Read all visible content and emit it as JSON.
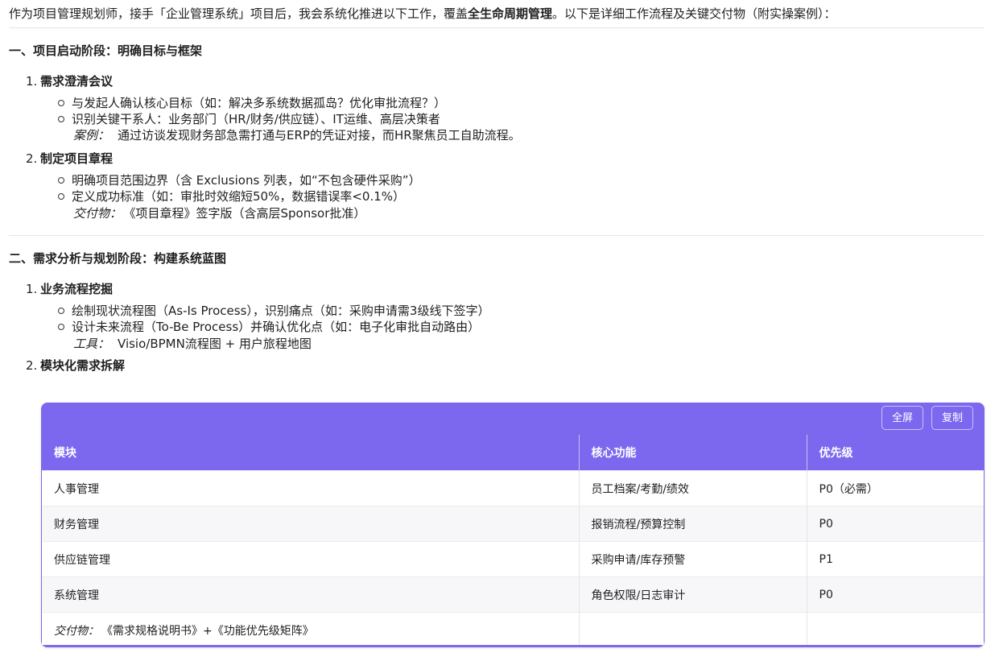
{
  "intro": {
    "part1": "作为项目管理规划师，接手「企业管理系统」项目后，我会系统化推进以下工作，覆盖",
    "bold": "全生命周期管理",
    "part2": "。以下是详细工作流程及关键交付物（附实操案例）："
  },
  "section1": {
    "title": "一、项目启动阶段：明确目标与框架",
    "item1": {
      "num": "1.",
      "title": "需求澄清会议",
      "bullets": [
        "与发起人确认核心目标（如：解决多系统数据孤岛？优化审批流程？）",
        "识别关键干系人：业务部门（HR/财务/供应链）、IT运维、高层决策者"
      ],
      "note_label": "案例：",
      "note_text": "通过访谈发现财务部急需打通与ERP的凭证对接，而HR聚焦员工自助流程。"
    },
    "item2": {
      "num": "2.",
      "title": "制定项目章程",
      "bullets": [
        "明确项目范围边界（含 Exclusions 列表，如“不包含硬件采购”）",
        "定义成功标准（如：审批时效缩短50%，数据错误率<0.1%）"
      ],
      "note_label": "交付物：",
      "note_text": "《项目章程》签字版（含高层Sponsor批准）"
    }
  },
  "section2": {
    "title": "二、需求分析与规划阶段：构建系统蓝图",
    "item1": {
      "num": "1.",
      "title": "业务流程挖掘",
      "bullets": [
        "绘制现状流程图（As-Is Process），识别痛点（如：采购申请需3级线下签字）",
        "设计未来流程（To-Be Process）并确认优化点（如：电子化审批自动路由）"
      ],
      "note_label": "工具：",
      "note_text": "Visio/BPMN流程图 + 用户旅程地图"
    },
    "item2": {
      "num": "2.",
      "title": "模块化需求拆解"
    }
  },
  "table": {
    "fullscreen_label": "全屏",
    "copy_label": "复制",
    "headers": [
      "模块",
      "核心功能",
      "优先级"
    ],
    "rows": [
      [
        "人事管理",
        "员工档案/考勤/绩效",
        "P0（必需）"
      ],
      [
        "财务管理",
        "报销流程/预算控制",
        "P0"
      ],
      [
        "供应链管理",
        "采购申请/库存预警",
        "P1"
      ],
      [
        "系统管理",
        "角色权限/日志审计",
        "P0"
      ]
    ],
    "footer_label": "交付物：",
    "footer_text": "《需求规格说明书》+《功能优先级矩阵》"
  },
  "colors": {
    "accent": "#7b68ee"
  }
}
